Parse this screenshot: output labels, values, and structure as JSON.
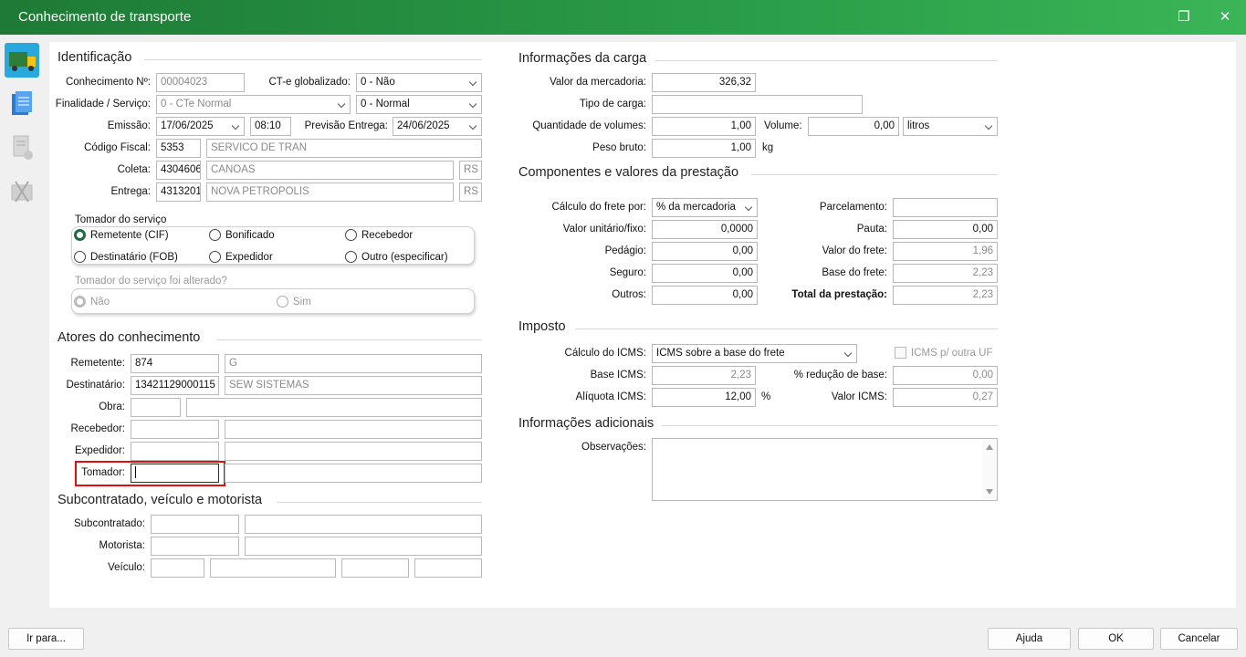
{
  "window": {
    "title": "Conhecimento de transporte"
  },
  "identificacao": {
    "title": "Identificação",
    "conhecimento_label": "Conhecimento Nº:",
    "conhecimento_value": "00004023",
    "globalizado_label": "CT-e globalizado:",
    "globalizado_value": "0 - Não",
    "finalidade_label": "Finalidade / Serviço:",
    "finalidade_value": "0 - CTe Normal",
    "servico_value": "0 - Normal",
    "emissao_label": "Emissão:",
    "emissao_date": "17/06/2025",
    "emissao_time": "08:10",
    "previsao_label": "Previsão Entrega:",
    "previsao_value": "24/06/2025",
    "cfop_label": "Código Fiscal:",
    "cfop_code": "5353",
    "cfop_desc": "SERVICO DE TRAN",
    "coleta_label": "Coleta:",
    "coleta_code": "4304606",
    "coleta_city": "CANOAS",
    "coleta_uf": "RS",
    "entrega_label": "Entrega:",
    "entrega_code": "4313201",
    "entrega_city": "NOVA PETROPOLIS",
    "entrega_uf": "RS"
  },
  "tomador": {
    "title": "Tomador do serviço",
    "options": [
      "Remetente (CIF)",
      "Bonificado",
      "Recebedor",
      "Destinatário (FOB)",
      "Expedidor",
      "Outro (especificar)"
    ],
    "alterado_title": "Tomador do serviço foi alterado?",
    "alterado_options": [
      "Não",
      "Sim"
    ]
  },
  "atores": {
    "title": "Atores do conhecimento",
    "remetente_label": "Remetente:",
    "remetente_code": "874",
    "remetente_name": "G",
    "destinatario_label": "Destinatário:",
    "destinatario_code": "13421129000115",
    "destinatario_name": "SEW SISTEMAS",
    "obra_label": "Obra:",
    "recebedor_label": "Recebedor:",
    "expedidor_label": "Expedidor:",
    "tomador_label": "Tomador:"
  },
  "subcontratado": {
    "title": "Subcontratado, veículo e motorista",
    "subcontratado_label": "Subcontratado:",
    "motorista_label": "Motorista:",
    "veiculo_label": "Veículo:"
  },
  "carga": {
    "title": "Informações da carga",
    "valor_label": "Valor da mercadoria:",
    "valor_value": "326,32",
    "tipo_label": "Tipo de carga:",
    "qtd_label": "Quantidade de volumes:",
    "qtd_value": "1,00",
    "volume_label": "Volume:",
    "volume_value": "0,00",
    "volume_unit": "litros",
    "peso_label": "Peso bruto:",
    "peso_value": "1,00",
    "peso_unit": "kg"
  },
  "componentes": {
    "title": "Componentes e valores da prestação",
    "calculo_label": "Cálculo do frete por:",
    "calculo_value": "% da mercadoria",
    "unitario_label": "Valor unitário/fixo:",
    "unitario_value": "0,0000",
    "pedagio_label": "Pedágio:",
    "pedagio_value": "0,00",
    "seguro_label": "Seguro:",
    "seguro_value": "0,00",
    "outros_label": "Outros:",
    "outros_value": "0,00",
    "parcelamento_label": "Parcelamento:",
    "pauta_label": "Pauta:",
    "pauta_value": "0,00",
    "valorfrete_label": "Valor do frete:",
    "valorfrete_value": "1,96",
    "basefrete_label": "Base do frete:",
    "basefrete_value": "2,23",
    "total_label": "Total da prestação:",
    "total_value": "2,23"
  },
  "imposto": {
    "title": "Imposto",
    "calculo_label": "Cálculo do ICMS:",
    "calculo_value": "ICMS sobre a base do frete",
    "outra_uf_label": "ICMS p/ outra UF",
    "base_label": "Base ICMS:",
    "base_value": "2,23",
    "reducao_label": "% redução de base:",
    "reducao_value": "0,00",
    "aliquota_label": "Alíquota ICMS:",
    "aliquota_value": "12,00",
    "aliquota_unit": "%",
    "valor_label": "Valor ICMS:",
    "valor_value": "0,27"
  },
  "adicionais": {
    "title": "Informações adicionais",
    "obs_label": "Observações:"
  },
  "footer": {
    "irpara": "Ir para...",
    "ajuda": "Ajuda",
    "ok": "OK",
    "cancelar": "Cancelar"
  }
}
